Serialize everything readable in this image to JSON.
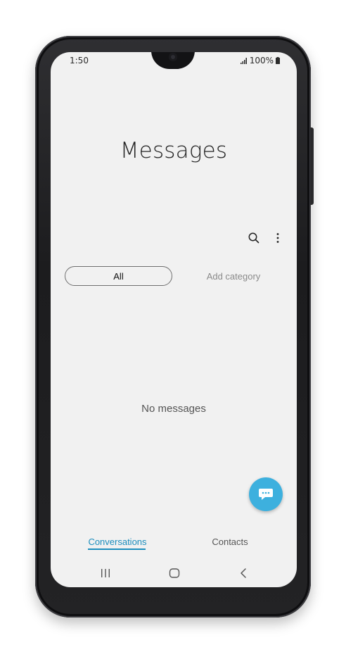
{
  "status_bar": {
    "time": "1:50",
    "battery": "100%",
    "signal_icon": "signal-bars-icon",
    "battery_icon": "battery-icon"
  },
  "header": {
    "title": "Messages",
    "search_icon": "search-icon",
    "more_icon": "more-vertical-icon"
  },
  "categories": {
    "selected_label": "All",
    "add_label": "Add category"
  },
  "empty_state": {
    "text": "No messages"
  },
  "fab": {
    "icon": "new-chat-icon",
    "color": "#3db0de"
  },
  "bottom_tabs": [
    {
      "label": "Conversations",
      "active": true
    },
    {
      "label": "Contacts",
      "active": false
    }
  ],
  "accent_color": "#1b8dbd",
  "nav_bar": {
    "recents_icon": "recents-icon",
    "home_icon": "home-icon",
    "back_icon": "back-icon"
  }
}
